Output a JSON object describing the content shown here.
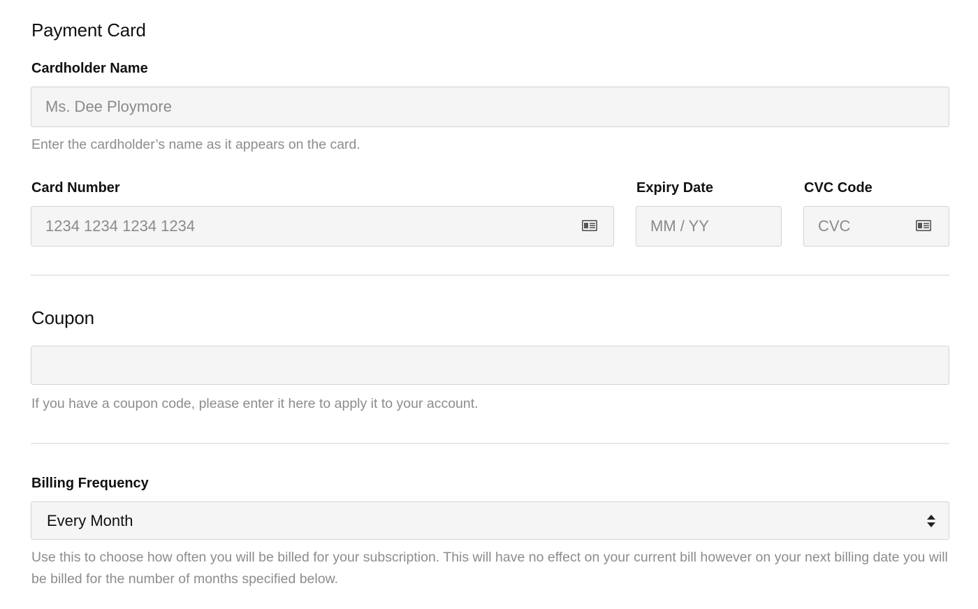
{
  "payment_card": {
    "title": "Payment Card",
    "cardholder_name": {
      "label": "Cardholder Name",
      "placeholder": "Ms. Dee Ploymore",
      "value": "",
      "help": "Enter the cardholder’s name as it appears on the card."
    },
    "card_number": {
      "label": "Card Number",
      "placeholder": "1234 1234 1234 1234",
      "value": "",
      "icon": "card-icon"
    },
    "expiry_date": {
      "label": "Expiry Date",
      "placeholder": "MM / YY",
      "value": ""
    },
    "cvc_code": {
      "label": "CVC Code",
      "placeholder": "CVC",
      "value": "",
      "icon": "card-icon"
    }
  },
  "coupon": {
    "title": "Coupon",
    "placeholder": "",
    "value": "",
    "help": "If you have a coupon code, please enter it here to apply it to your account."
  },
  "billing_frequency": {
    "label": "Billing Frequency",
    "selected": "Every Month",
    "icon": "select-arrows-icon",
    "help": "Use this to choose how often you will be billed for your subscription. This will have no effect on your current bill however on your next billing date you will be billed for the number of months specified below."
  },
  "colors": {
    "input_background": "#f5f5f5",
    "input_border": "#d3d3d3",
    "help_text": "#8c8c8c",
    "divider": "#e8e8e8",
    "icon": "#555555"
  }
}
